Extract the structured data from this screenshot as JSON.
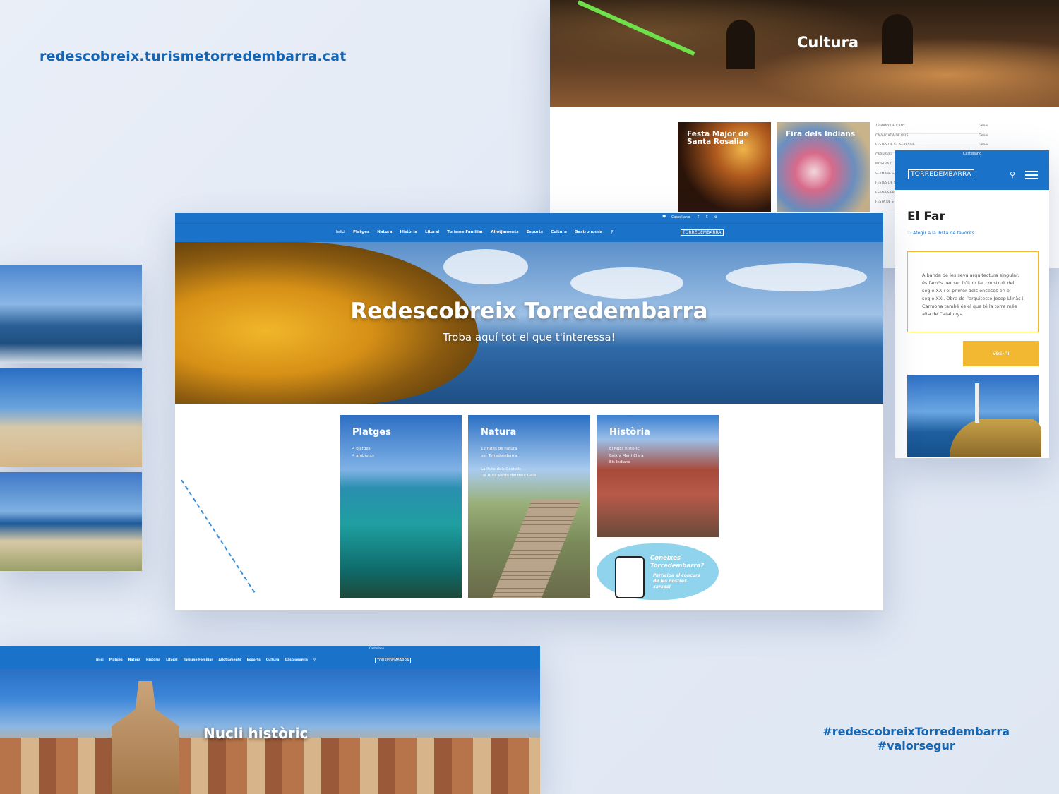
{
  "site_url": "redescobreix.turismetorredembarra.cat",
  "hashtags": [
    "#redescobreixTorredembarra",
    "#valorsegur"
  ],
  "culture_page": {
    "hero_title": "Cultura",
    "cards": [
      "Festa Major de Santa Rosalia",
      "Fira dels Indians"
    ],
    "agenda": [
      {
        "name": "1R BANY DE L'ANY",
        "month": "Gener"
      },
      {
        "name": "CAVALCADA DE REIS",
        "month": "Gener"
      },
      {
        "name": "FESTES DE ST. SEBASTIÀ",
        "month": "Gener"
      },
      {
        "name": "CARNAVAL",
        "month": ""
      },
      {
        "name": "MOSTRA D",
        "month": ""
      },
      {
        "name": "SETMANA SA",
        "month": ""
      },
      {
        "name": "FESTES DE S",
        "month": ""
      },
      {
        "name": "ESTAPES PR",
        "month": ""
      },
      {
        "name": "FESTA DE S",
        "month": ""
      }
    ]
  },
  "mobile_page": {
    "lang": "Castellano",
    "logo": "TORREDEMBARRA",
    "title": "El Far",
    "favorite_link": "Afegir a la llista de favorits",
    "description": "A banda de les seva arquitectura singular, és famós per ser l'últim far construït del segle XX i el primer dels encesos en el segle XXI. Obra de l'arquitecte Josep Llinàs i Carmona també és el que té la torre més alta de Catalunya.",
    "button": "Vés-hi"
  },
  "main_page": {
    "lang": "Castellano",
    "social": [
      "f",
      "t",
      "o"
    ],
    "menu": [
      "Inici",
      "Platges",
      "Natura",
      "Història",
      "Litoral",
      "Turisme Familiar",
      "Allotjaments",
      "Esports",
      "Cultura",
      "Gastronomia"
    ],
    "logo": "TORREDEMBARRA",
    "hero_title": "Redescobreix Torredembarra",
    "hero_subtitle": "Troba aquí tot el que t'interessa!",
    "cards": [
      {
        "title": "Platges",
        "lines": [
          "4 platges",
          "4 ambients"
        ]
      },
      {
        "title": "Natura",
        "lines": [
          "12 rutes de natura",
          "per Torredembarra",
          "",
          "La Ruta dels Castells",
          "i la Ruta Verda del Baix Gaià"
        ]
      },
      {
        "title": "Història",
        "lines": [
          "El Nucli històric",
          "Baix a Mar i Clarà",
          "Els Indians"
        ]
      }
    ],
    "promo": {
      "question": "Coneixes Torredembarra?",
      "cta": "Participa al concurs de les nostres xarxes!"
    }
  },
  "nucli_page": {
    "lang": "Castellano",
    "menu": [
      "Inici",
      "Platges",
      "Natura",
      "Història",
      "Litoral",
      "Turisme Familiar",
      "Allotjaments",
      "Esports",
      "Cultura",
      "Gastronomia"
    ],
    "logo": "TORREDEMBARRA",
    "hero_title": "Nucli històric"
  },
  "colors": {
    "brand_blue": "#1a73c9",
    "accent_yellow": "#f2b832",
    "text_blue": "#1466b5"
  }
}
